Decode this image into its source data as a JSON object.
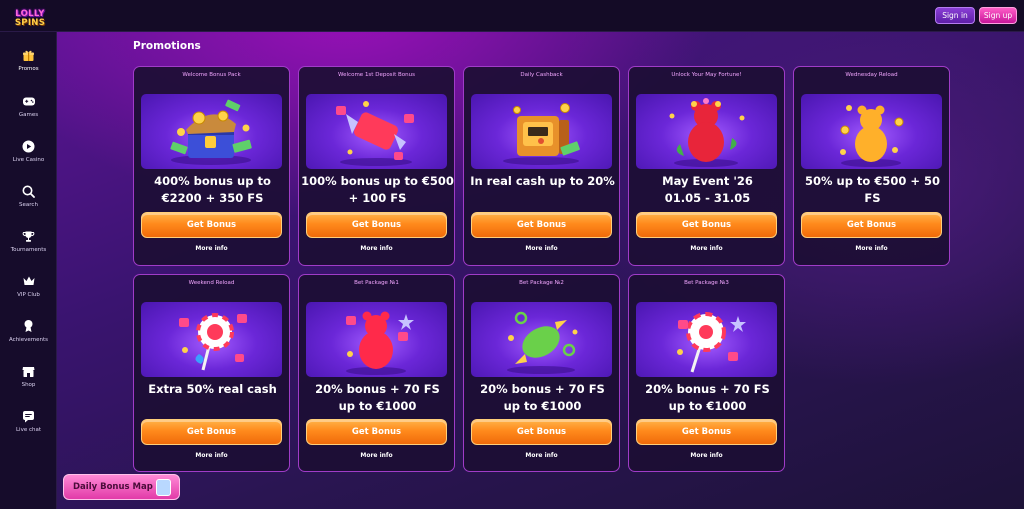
{
  "app": {
    "logo_line1": "LOLLY",
    "logo_line2": "SPINS"
  },
  "header": {
    "signin_label": "Sign in",
    "signup_label": "Sign up"
  },
  "sidebar": {
    "items": [
      {
        "label": "Promos",
        "icon": "gift-icon"
      },
      {
        "label": "Games",
        "icon": "gamepad-icon"
      },
      {
        "label": "Live Casino",
        "icon": "play-icon"
      },
      {
        "label": "Search",
        "icon": "search-icon"
      },
      {
        "label": "Tournaments",
        "icon": "trophy-icon"
      },
      {
        "label": "VIP Club",
        "icon": "crown-icon"
      },
      {
        "label": "Achievements",
        "icon": "medal-icon"
      },
      {
        "label": "Shop",
        "icon": "shop-icon"
      },
      {
        "label": "Live chat",
        "icon": "chat-icon"
      }
    ]
  },
  "page": {
    "title": "Promotions"
  },
  "promotions": [
    {
      "head": "Welcome Bonus Pack",
      "title_l1": "400% bonus up to",
      "title_l2": "€2200 + 350 FS",
      "button": "Get Bonus",
      "more": "More info",
      "image": "treasure-chest-image"
    },
    {
      "head": "Welcome 1st Deposit Bonus",
      "title_l1": "100% bonus up to €500",
      "title_l2": "+ 100 FS",
      "button": "Get Bonus",
      "more": "More info",
      "image": "candy-image"
    },
    {
      "head": "Daily Cashback",
      "title_l1": "In real cash up to 20%",
      "title_l2": "",
      "button": "Get Bonus",
      "more": "More info",
      "image": "safe-image"
    },
    {
      "head": "Unlock Your May Fortune!",
      "title_l1": "May Event '26",
      "title_l2": "01.05 - 31.05",
      "button": "Get Bonus",
      "more": "More info",
      "image": "red-gummy-bear-image"
    },
    {
      "head": "Wednesday Reload",
      "title_l1": "50% up to €500 + 50 FS",
      "title_l2": "",
      "button": "Get Bonus",
      "more": "More info",
      "image": "gold-gummy-bear-image"
    },
    {
      "head": "Weekend Reload",
      "title_l1": "Extra 50% real cash",
      "title_l2": "",
      "button": "Get Bonus",
      "more": "More info",
      "image": "lollipop-image"
    },
    {
      "head": "Bet Package №1",
      "title_l1": "20% bonus + 70 FS",
      "title_l2": "up to €1000",
      "button": "Get Bonus",
      "more": "More info",
      "image": "red-gummy-bear-image"
    },
    {
      "head": "Bet Package №2",
      "title_l1": "20% bonus + 70 FS",
      "title_l2": "up to €1000",
      "button": "Get Bonus",
      "more": "More info",
      "image": "green-candy-image"
    },
    {
      "head": "Bet Package №3",
      "title_l1": "20% bonus + 70 FS",
      "title_l2": "up to €1000",
      "button": "Get Bonus",
      "more": "More info",
      "image": "lollipop-image"
    }
  ],
  "footer_widget": {
    "label": "Daily Bonus Map"
  },
  "colors": {
    "accent_orange": "#ff8a1c",
    "accent_pink": "#ff5ec8",
    "card_border": "#a03cc8",
    "heading_pink": "#f2a6ff"
  }
}
